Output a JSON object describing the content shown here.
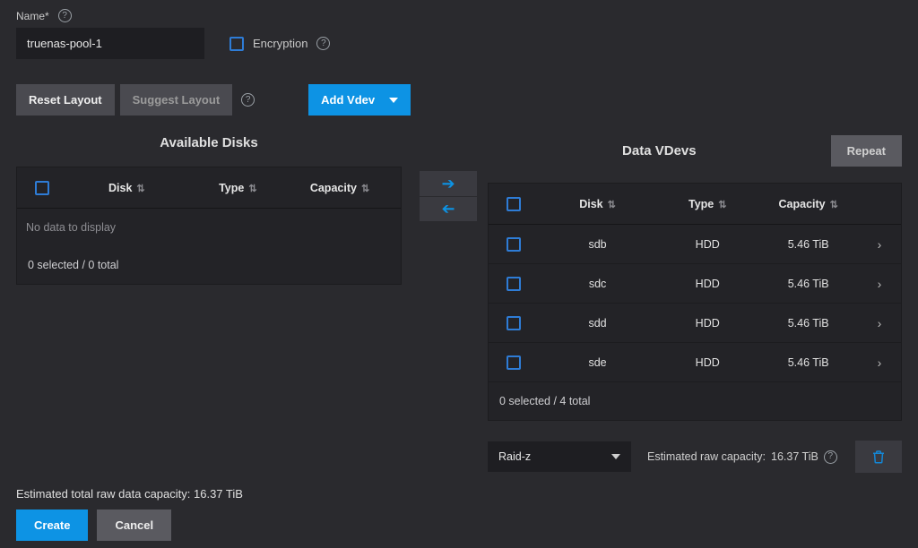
{
  "name_field": {
    "label": "Name*",
    "value": "truenas-pool-1"
  },
  "encryption": {
    "label": "Encryption",
    "checked": false
  },
  "buttons": {
    "reset_layout": "Reset Layout",
    "suggest_layout": "Suggest Layout",
    "add_vdev": "Add Vdev",
    "repeat": "Repeat",
    "create": "Create",
    "cancel": "Cancel"
  },
  "headers": {
    "disk": "Disk",
    "type": "Type",
    "capacity": "Capacity"
  },
  "available": {
    "title": "Available Disks",
    "empty": "No data to display",
    "footer": "0 selected / 0 total",
    "rows": []
  },
  "vdevs": {
    "title": "Data VDevs",
    "footer": "0 selected / 4 total",
    "rows": [
      {
        "disk": "sdb",
        "type": "HDD",
        "capacity": "5.46 TiB"
      },
      {
        "disk": "sdc",
        "type": "HDD",
        "capacity": "5.46 TiB"
      },
      {
        "disk": "sdd",
        "type": "HDD",
        "capacity": "5.46 TiB"
      },
      {
        "disk": "sde",
        "type": "HDD",
        "capacity": "5.46 TiB"
      }
    ]
  },
  "raid": {
    "selected": "Raid-z",
    "estimated_label": "Estimated raw capacity:",
    "estimated_value": "16.37 TiB"
  },
  "footer": {
    "total_label": "Estimated total raw data capacity:",
    "total_value": "16.37 TiB"
  }
}
